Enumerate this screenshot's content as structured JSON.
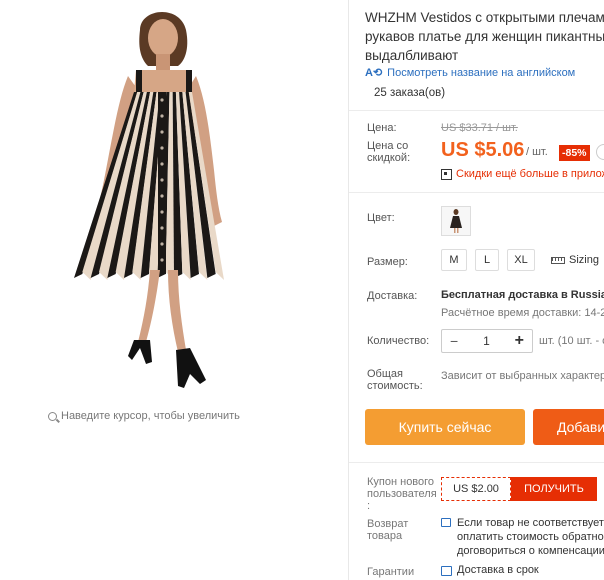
{
  "product": {
    "title_lines": [
      "WHZHM Vestidos с открытыми плечами",
      "рукавов платье для женщин пикантные",
      "выдалбливают"
    ],
    "translate_link": "Посмотреть название на английском",
    "orders": "25 заказа(ов)"
  },
  "gallery": {
    "zoom_hint": "Наведите курсор, чтобы увеличить",
    "colors": {
      "stripe_dark": "#1b1816",
      "stripe_light": "#e9d9c8"
    }
  },
  "price": {
    "label": "Цена:",
    "old_value": "US $33.71 / шт.",
    "discount_label": "Цена со скидкой:",
    "new_value": "US $5.06",
    "unit": "/ шт.",
    "discount_badge": "-85%",
    "promo_text": "Скидки ещё больше в прилож"
  },
  "options": {
    "color_label": "Цвет:",
    "size_label": "Размер:",
    "sizes": [
      "M",
      "L",
      "XL"
    ],
    "sizing_link": "Sizing"
  },
  "shipping": {
    "label": "Доставка:",
    "main": "Бесплатная доставка в Russian",
    "sub": "Расчётное время доставки: 14-2"
  },
  "quantity": {
    "label": "Количество:",
    "value": "1",
    "minus": "−",
    "plus": "+",
    "note": "шт. (10 шт. - с"
  },
  "total": {
    "label": "Общая стоимость:",
    "note": "Зависит от выбранных характер"
  },
  "actions": {
    "buy_now": "Купить сейчас",
    "add_to_cart": "Добавит"
  },
  "coupon": {
    "label": "Купон нового пользователя :",
    "value": "US $2.00",
    "button": "ПОЛУЧИТЬ"
  },
  "returns": {
    "label": "Возврат товара",
    "lines": [
      "Если товар не соответствует",
      "оплатить стоимость обратной",
      "договориться о компенсации"
    ]
  },
  "guarantee": {
    "label": "Гарантии",
    "text": "Доставка в срок"
  },
  "theme": {
    "accent": "#f2611d",
    "buy": "#f49d32",
    "cart": "#ef5c16",
    "badge": "#e62e04",
    "link": "#2c6fbf"
  }
}
